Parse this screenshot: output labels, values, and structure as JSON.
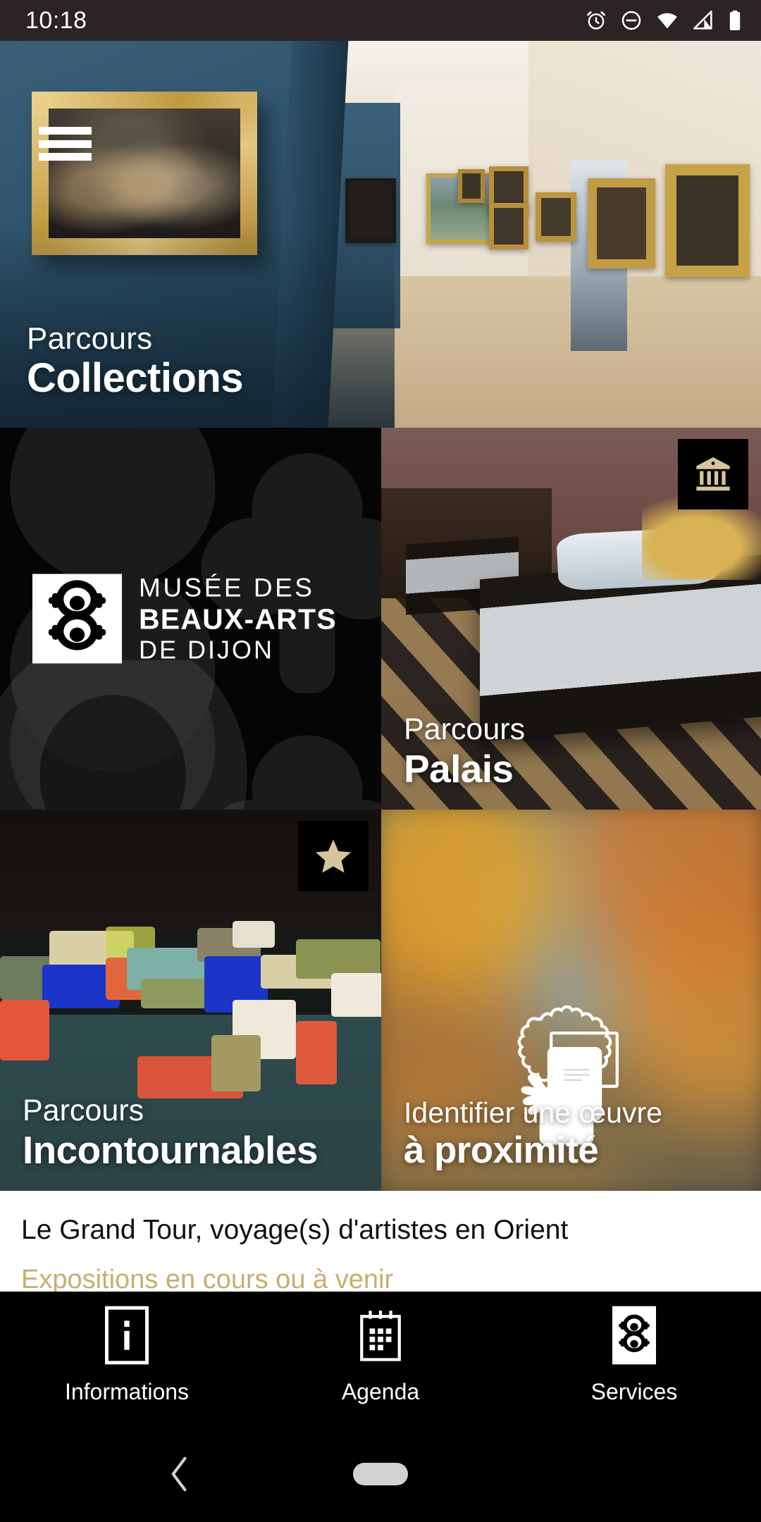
{
  "statusbar": {
    "time": "10:18",
    "icons": [
      "alarm-icon",
      "do-not-disturb-icon",
      "wifi-icon",
      "cellular-signal-icon",
      "battery-icon"
    ]
  },
  "hero": {
    "menu_icon": "hamburger-menu-icon",
    "caption_top": "Parcours",
    "caption_main": "Collections"
  },
  "tiles": {
    "logo": {
      "line1": "MUSÉE DES",
      "line2": "BEAUX-ARTS",
      "line3": "DE DIJON",
      "mark_icon": "quatrefoil-logo-icon"
    },
    "palais": {
      "caption_top": "Parcours",
      "caption_main": "Palais",
      "badge_icon": "classical-building-icon"
    },
    "incontournables": {
      "caption_top": "Parcours",
      "caption_main": "Incontournables",
      "badge_icon": "star-icon"
    },
    "proximite": {
      "caption_top": "Identifier une œuvre",
      "caption_main": "à proximité",
      "icon": "hand-holding-phone-frame-icon"
    }
  },
  "news": {
    "title": "Le Grand Tour, voyage(s) d'artistes en Orient",
    "subtitle": "Expositions en cours ou à venir"
  },
  "bottom_nav": {
    "items": [
      {
        "label": "Informations",
        "icon": "info-icon"
      },
      {
        "label": "Agenda",
        "icon": "calendar-icon"
      },
      {
        "label": "Services",
        "icon": "quatrefoil-logo-icon"
      }
    ]
  },
  "android_nav": {
    "back_icon": "back-chevron-icon",
    "home_icon": "home-pill-icon"
  },
  "colors": {
    "accent_gold": "#c6ae6e",
    "badge_gold": "#d6c49a",
    "hero_blue": "#30556d",
    "black": "#000000"
  }
}
